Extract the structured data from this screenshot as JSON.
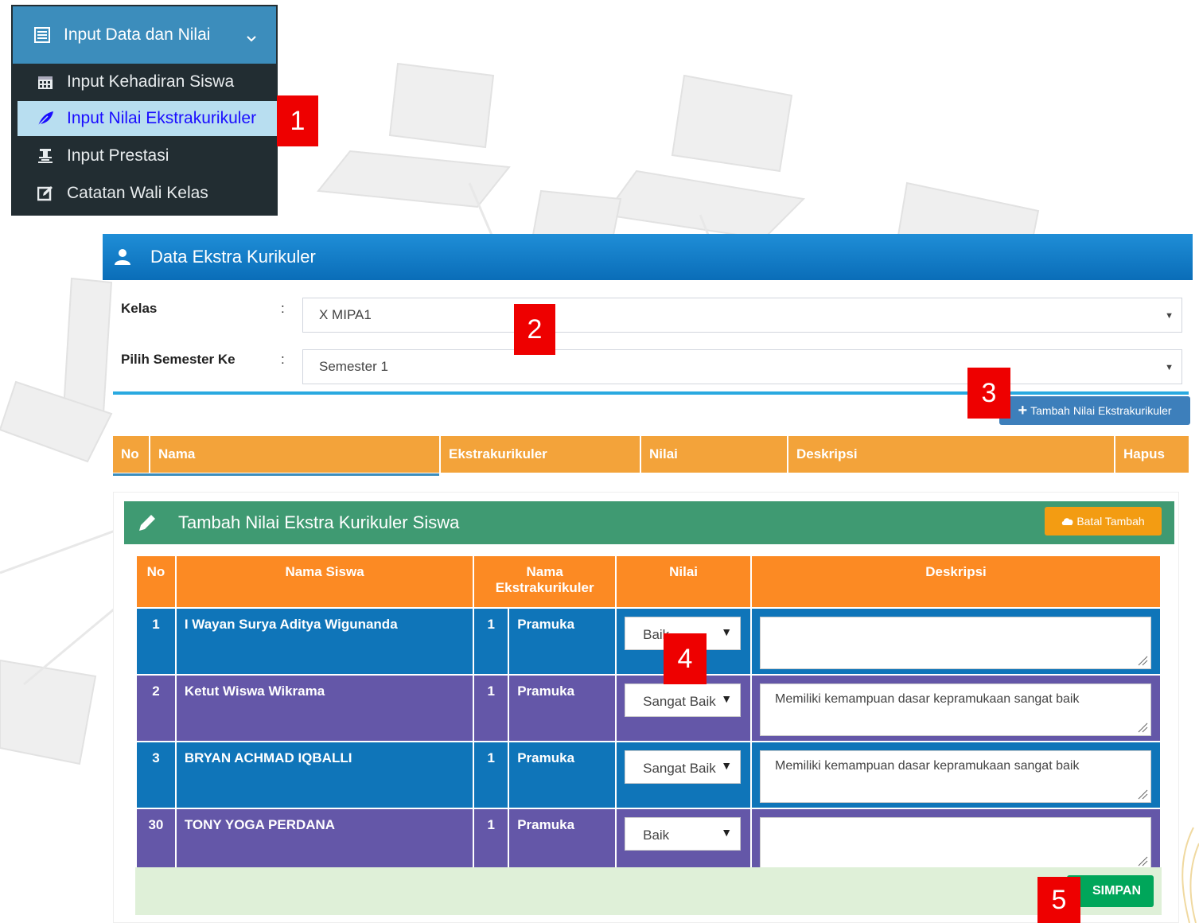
{
  "sidebar": {
    "parent_label": "Input Data dan Nilai",
    "items": [
      {
        "label": "Input Kehadiran Siswa"
      },
      {
        "label": "Input Nilai Ekstrakurikuler"
      },
      {
        "label": "Input Prestasi"
      },
      {
        "label": "Catatan Wali Kelas"
      }
    ]
  },
  "badges": [
    "1",
    "2",
    "3",
    "4",
    "5"
  ],
  "data_panel": {
    "title": "Data Ekstra Kurikuler",
    "kelas_label": "Kelas",
    "kelas_value": "X MIPA1",
    "semester_label": "Pilih Semester Ke",
    "semester_value": "Semester 1",
    "colon": ":",
    "add_button": "Tambah Nilai Ekstrakurikuler",
    "columns": [
      "No",
      "Nama",
      "Ekstrakurikuler",
      "Nilai",
      "Deskripsi",
      "Hapus"
    ]
  },
  "tambah_panel": {
    "title": "Tambah Nilai Ekstra Kurikuler Siswa",
    "batal_button": "Batal Tambah",
    "columns": [
      "No",
      "Nama Siswa",
      "Nama Ekstrakurikuler",
      "Nilai",
      "Deskripsi"
    ],
    "rows": [
      {
        "no": "1",
        "nama": "I Wayan Surya Aditya Wigunanda",
        "ekskul_no": "1",
        "ekskul": "Pramuka",
        "nilai": "Baik",
        "deskripsi": ""
      },
      {
        "no": "2",
        "nama": "Ketut Wiswa Wikrama",
        "ekskul_no": "1",
        "ekskul": "Pramuka",
        "nilai": "Sangat Baik",
        "deskripsi": "Memiliki kemampuan dasar kepramukaan sangat baik"
      },
      {
        "no": "3",
        "nama": "BRYAN ACHMAD IQBALLI",
        "ekskul_no": "1",
        "ekskul": "Pramuka",
        "nilai": "Sangat Baik",
        "deskripsi": "Memiliki kemampuan dasar kepramukaan sangat baik"
      },
      {
        "no": "30",
        "nama": "TONY YOGA PERDANA",
        "ekskul_no": "1",
        "ekskul": "Pramuka",
        "nilai": "Baik",
        "deskripsi": ""
      }
    ],
    "save_button": "SIMPAN"
  },
  "colors": {
    "sidebar_bg": "#222d32",
    "sidebar_parent": "#3c8dbc",
    "sidebar_active": "#b8def0",
    "panel_blue": "#0a6db8",
    "table_orange": "#f3a33a",
    "green_header": "#3f9a72",
    "row_blue": "#0f75b9",
    "row_purple": "#6457a8",
    "badge_red": "#ee0000",
    "save_green": "#00a65a"
  }
}
